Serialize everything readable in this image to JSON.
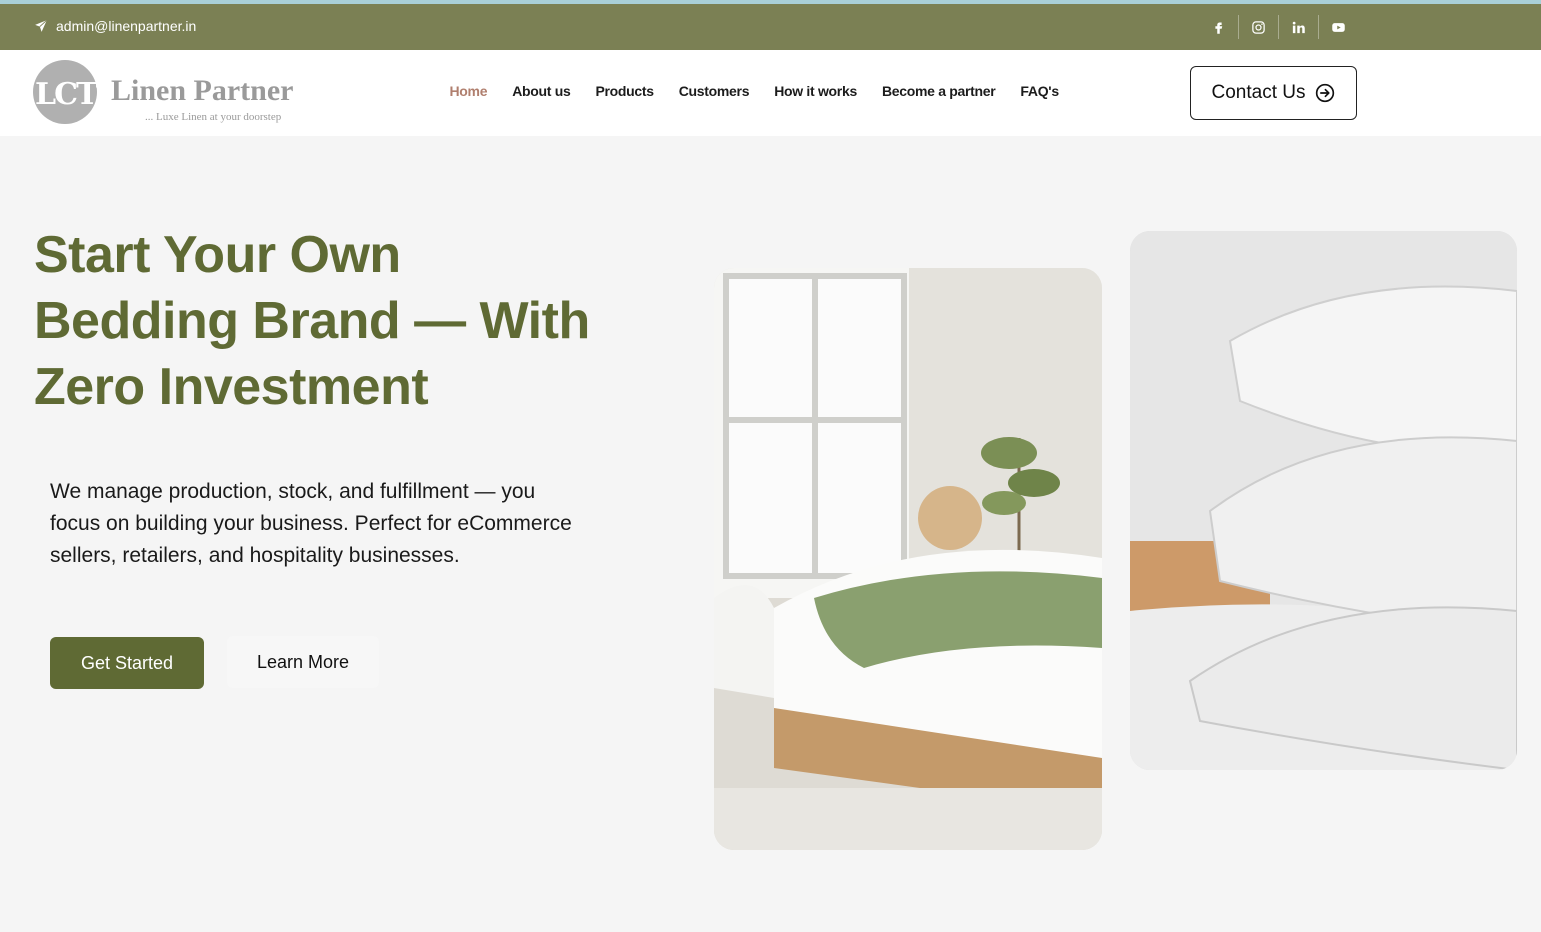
{
  "topbar": {
    "email": "admin@linenpartner.in",
    "email_icon": "send-icon",
    "socials": [
      "facebook-icon",
      "instagram-icon",
      "linkedin-icon",
      "youtube-icon"
    ]
  },
  "header": {
    "logo": {
      "mark": "LCT",
      "name": "Linen Partner",
      "tagline": "... Luxe Linen at your doorstep"
    },
    "nav": [
      "Home",
      "About us",
      "Products",
      "Customers",
      "How it works",
      "Become a partner",
      "FAQ's"
    ],
    "active_nav": "Home",
    "contact_label": "Contact Us",
    "contact_icon": "arrow-right-circle-icon"
  },
  "hero": {
    "title_lines": [
      "Start Your Own",
      "Bedding Brand — With",
      "Zero Investment"
    ],
    "description": "We manage production, stock, and fulfillment — you focus on building your business. Perfect for eCommerce sellers, retailers, and hospitality businesses.",
    "primary_cta": "Get Started",
    "secondary_cta": "Learn More"
  },
  "colors": {
    "topbar": "#7b8054",
    "brand_green": "#5f6a34",
    "nav_active": "#b07f6e"
  }
}
